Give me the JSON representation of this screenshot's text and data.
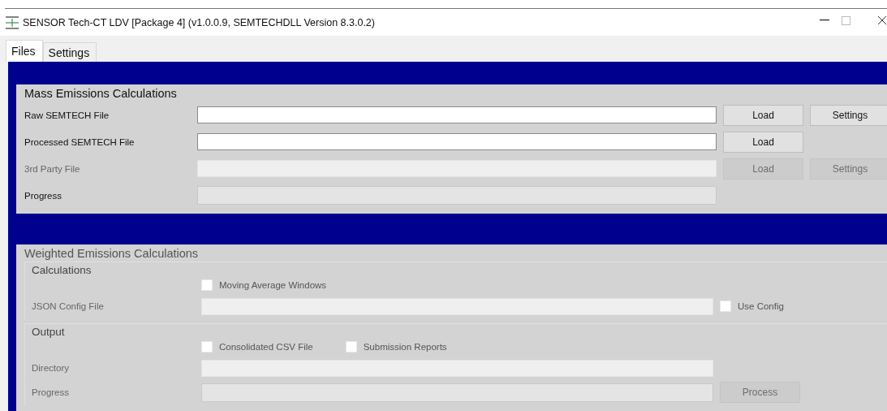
{
  "window": {
    "title": "SENSOR Tech-CT LDV [Package 4] (v1.0.0.9, SEMTECHDLL Version 8.3.0.2)"
  },
  "tabs": [
    {
      "label": "Files",
      "selected": true
    },
    {
      "label": "Settings",
      "selected": false
    }
  ],
  "mass_emissions": {
    "title": "Mass Emissions Calculations",
    "rows": [
      {
        "kind": "file",
        "label": "Raw SEMTECH File",
        "disabled": false,
        "buttons": [
          {
            "label": "Load",
            "disabled": false
          },
          {
            "label": "Settings",
            "disabled": false
          }
        ]
      },
      {
        "kind": "file",
        "label": "Processed SEMTECH File",
        "disabled": false,
        "buttons": [
          {
            "label": "Load",
            "disabled": false
          }
        ]
      },
      {
        "kind": "file",
        "label": "3rd Party File",
        "disabled": true,
        "buttons": [
          {
            "label": "Load",
            "disabled": true
          },
          {
            "label": "Settings",
            "disabled": true
          }
        ]
      },
      {
        "kind": "progress",
        "label": "Progress",
        "level": 0
      }
    ]
  },
  "weighted_emissions": {
    "title": "Weighted Emissions Calculations",
    "disabled": true,
    "groups": [
      {
        "title": "Calculations",
        "rows": [
          {
            "kind": "checks",
            "checks": [
              {
                "label": "Moving Average Windows",
                "checked": false
              }
            ]
          },
          {
            "kind": "file",
            "label": "JSON Config File",
            "check": {
              "label": "Use Config",
              "checked": false
            }
          }
        ]
      },
      {
        "title": "Output",
        "rows": [
          {
            "kind": "checks",
            "checks": [
              {
                "label": "Consolidated CSV File",
                "checked": false
              },
              {
                "label": "Submission Reports",
                "checked": false
              }
            ]
          },
          {
            "kind": "file",
            "label": "Directory"
          },
          {
            "kind": "progress",
            "label": "Progress",
            "level": 0,
            "button": {
              "label": "Process",
              "disabled": true
            }
          }
        ]
      }
    ]
  }
}
